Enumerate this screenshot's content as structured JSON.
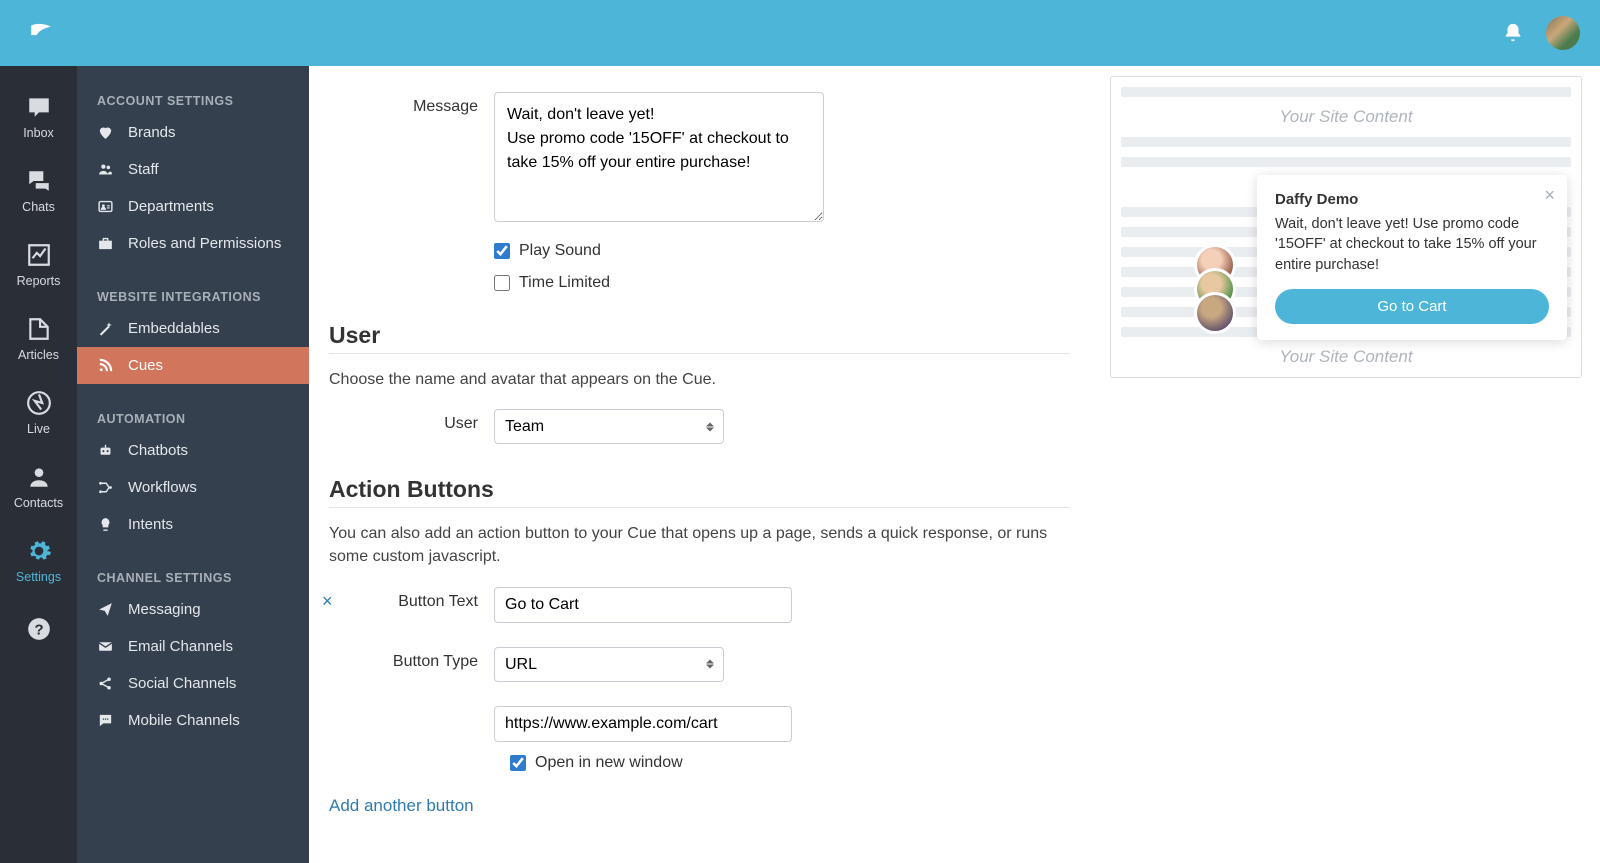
{
  "topbar": {
    "notification_label": "Notifications"
  },
  "rail": {
    "items": [
      {
        "label": "Inbox"
      },
      {
        "label": "Chats"
      },
      {
        "label": "Reports"
      },
      {
        "label": "Articles"
      },
      {
        "label": "Live"
      },
      {
        "label": "Contacts"
      },
      {
        "label": "Settings"
      }
    ]
  },
  "sidebar": {
    "sections": [
      {
        "heading": "ACCOUNT SETTINGS",
        "items": [
          {
            "label": "Brands"
          },
          {
            "label": "Staff"
          },
          {
            "label": "Departments"
          },
          {
            "label": "Roles and Permissions"
          }
        ]
      },
      {
        "heading": "WEBSITE INTEGRATIONS",
        "items": [
          {
            "label": "Embeddables"
          },
          {
            "label": "Cues",
            "active": true
          }
        ]
      },
      {
        "heading": "AUTOMATION",
        "items": [
          {
            "label": "Chatbots"
          },
          {
            "label": "Workflows"
          },
          {
            "label": "Intents"
          }
        ]
      },
      {
        "heading": "CHANNEL SETTINGS",
        "items": [
          {
            "label": "Messaging"
          },
          {
            "label": "Email Channels"
          },
          {
            "label": "Social Channels"
          },
          {
            "label": "Mobile Channels"
          }
        ]
      }
    ]
  },
  "form": {
    "message_label": "Message",
    "message_value": "Wait, don't leave yet!\nUse promo code '15OFF' at checkout to take 15% off your entire purchase!",
    "play_sound_label": "Play Sound",
    "play_sound_checked": true,
    "time_limited_label": "Time Limited",
    "time_limited_checked": false,
    "user_section_title": "User",
    "user_section_help": "Choose the name and avatar that appears on the Cue.",
    "user_label": "User",
    "user_value": "Team",
    "action_section_title": "Action Buttons",
    "action_section_help": "You can also add an action button to your Cue that opens up a page, sends a quick response, or runs some custom javascript.",
    "button_text_label": "Button Text",
    "button_text_value": "Go to Cart",
    "button_type_label": "Button Type",
    "button_type_value": "URL",
    "url_value": "https://www.example.com/cart",
    "open_new_window_label": "Open in new window",
    "open_new_window_checked": true,
    "add_another_label": "Add another button"
  },
  "preview": {
    "site_placeholder": "Your Site Content",
    "cue_title": "Daffy Demo",
    "cue_body": "Wait, don't leave yet!\nUse promo code '15OFF' at checkout to take 15% off your entire purchase!",
    "cue_button": "Go to Cart"
  }
}
